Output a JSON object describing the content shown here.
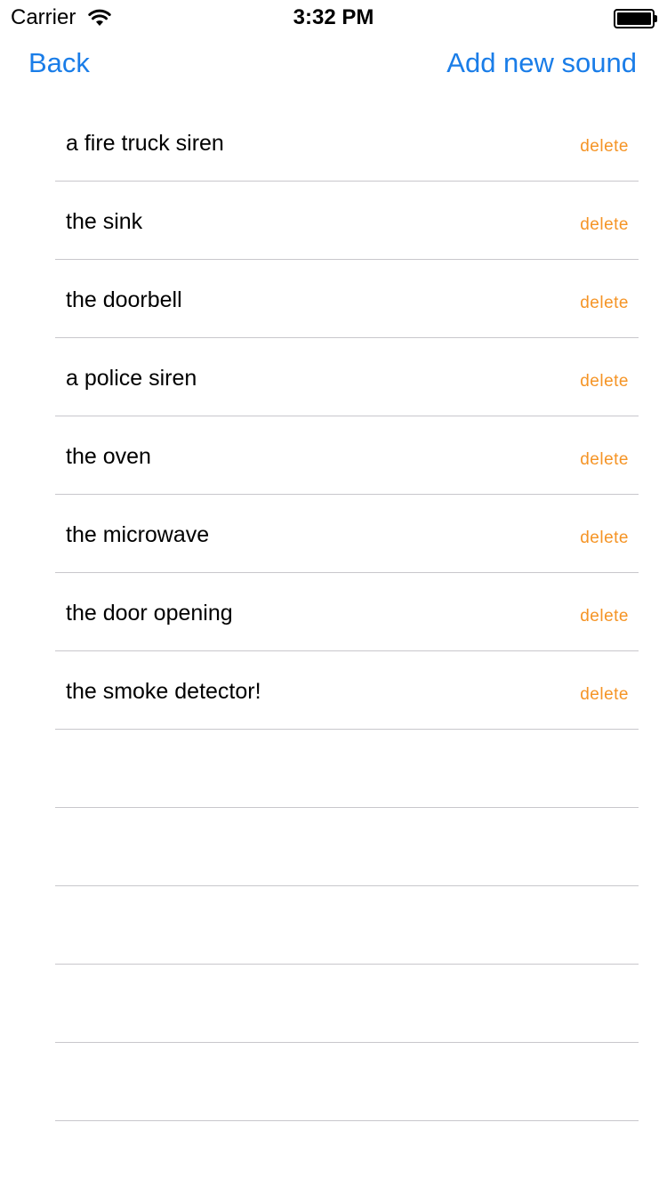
{
  "status_bar": {
    "carrier": "Carrier",
    "wifi_icon": "wifi-icon",
    "time": "3:32 PM",
    "battery_icon": "battery-icon"
  },
  "nav": {
    "back_label": "Back",
    "add_label": "Add new sound"
  },
  "colors": {
    "accent": "#1a7de8",
    "delete": "#f59425",
    "separator": "#c8c7cc"
  },
  "sounds": [
    {
      "name": "a fire truck siren",
      "delete_label": "delete"
    },
    {
      "name": "the sink",
      "delete_label": "delete"
    },
    {
      "name": "the doorbell",
      "delete_label": "delete"
    },
    {
      "name": "a police siren",
      "delete_label": "delete"
    },
    {
      "name": "the oven",
      "delete_label": "delete"
    },
    {
      "name": "the microwave",
      "delete_label": "delete"
    },
    {
      "name": "the door opening",
      "delete_label": "delete"
    },
    {
      "name": "the smoke detector!",
      "delete_label": "delete"
    }
  ],
  "empty_row_count": 5
}
